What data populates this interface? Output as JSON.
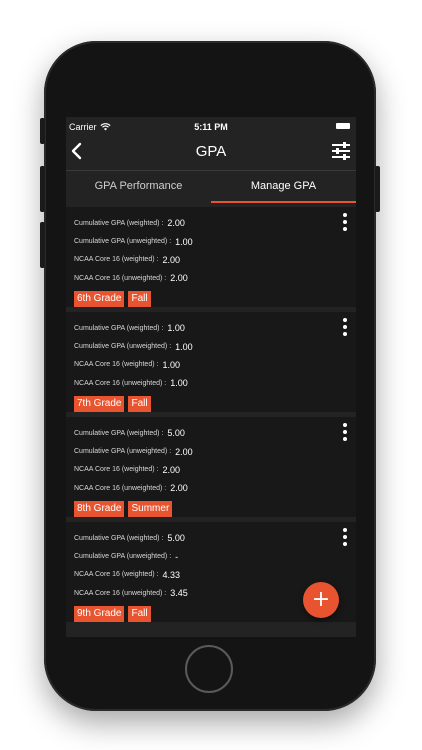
{
  "status_bar": {
    "carrier": "Carrier",
    "time": "5:11 PM"
  },
  "nav": {
    "title": "GPA"
  },
  "tabs": [
    {
      "label": "GPA Performance",
      "active": false
    },
    {
      "label": "Manage GPA",
      "active": true
    }
  ],
  "cards": [
    {
      "rows": [
        {
          "label": "Cumulative GPA (weighted) :",
          "value": "2.00"
        },
        {
          "label": "Cumulative GPA (unweighted) :",
          "value": "1.00"
        },
        {
          "label": "NCAA Core 16 (weighted) :",
          "value": "2.00"
        },
        {
          "label": "NCAA Core 16 (unweighted) :",
          "value": "2.00"
        }
      ],
      "grade": "6th Grade",
      "term": "Fall"
    },
    {
      "rows": [
        {
          "label": "Cumulative GPA (weighted) :",
          "value": "1.00"
        },
        {
          "label": "Cumulative GPA (unweighted) :",
          "value": "1.00"
        },
        {
          "label": "NCAA Core 16 (weighted) :",
          "value": "1.00"
        },
        {
          "label": "NCAA Core 16 (unweighted) :",
          "value": "1.00"
        }
      ],
      "grade": "7th Grade",
      "term": "Fall"
    },
    {
      "rows": [
        {
          "label": "Cumulative GPA (weighted) :",
          "value": "5.00"
        },
        {
          "label": "Cumulative GPA (unweighted) :",
          "value": "2.00"
        },
        {
          "label": "NCAA Core 16 (weighted) :",
          "value": "2.00"
        },
        {
          "label": "NCAA Core 16 (unweighted) :",
          "value": "2.00"
        }
      ],
      "grade": "8th Grade",
      "term": "Summer"
    },
    {
      "rows": [
        {
          "label": "Cumulative GPA (weighted) :",
          "value": "5.00"
        },
        {
          "label": "Cumulative GPA (unweighted) :",
          "value": "-"
        },
        {
          "label": "NCAA Core 16 (weighted) :",
          "value": "4.33"
        },
        {
          "label": "NCAA Core 16 (unweighted) :",
          "value": "3.45"
        }
      ],
      "grade": "9th Grade",
      "term": "Fall"
    }
  ],
  "fab": {
    "label": "+"
  },
  "colors": {
    "accent": "#e8542f",
    "background": "#232323",
    "card": "#181818"
  },
  "icons": {
    "back": "chevron-left-icon",
    "filter": "sliders-icon",
    "more": "vertical-ellipsis-icon",
    "wifi": "wifi-icon"
  }
}
